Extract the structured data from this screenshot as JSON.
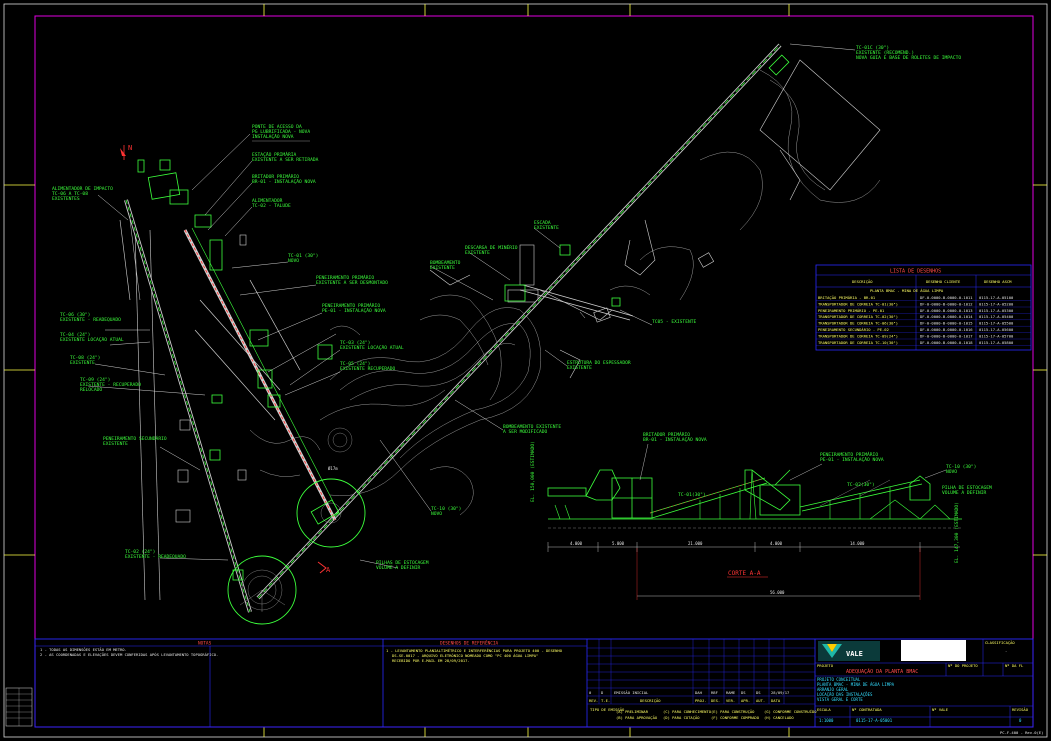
{
  "colors": {
    "background": "#000000",
    "border": "#e000e0",
    "equipment": "#3cff3c",
    "structure": "#d8d8d8",
    "titleblock": "#2a2aff",
    "accent_red": "#ff3333",
    "yellow": "#ffff44",
    "cyan": "#33ddff"
  },
  "north_mark": "N",
  "cut_marker": "A",
  "callouts": [
    {
      "id": "ponte",
      "lines": [
        "PONTE DE ACESSO DA",
        "PG LUBRIFICADA - NOVA",
        "INSTALAÇÃO NOVA"
      ]
    },
    {
      "id": "estacao",
      "lines": [
        "ESTAÇÃO PRIMÁRIA",
        "EXISTENTE A SER RETIRADA"
      ]
    },
    {
      "id": "britador",
      "lines": [
        "BRITADOR PRIMÁRIO",
        "BR-01 - INSTALAÇÃO NOVA"
      ]
    },
    {
      "id": "alimentador",
      "lines": [
        "ALIMENTADOR",
        "TC-02 - TALUDE"
      ]
    },
    {
      "id": "tc01",
      "lines": [
        "TC-01 (30\")",
        "NOVO"
      ]
    },
    {
      "id": "peneira",
      "lines": [
        "PENEIRAMENTO PRIMÁRIO",
        "EXISTENTE A SER DESMONTADO"
      ]
    },
    {
      "id": "peneira2",
      "lines": [
        "PENEIRAMENTO PRIMÁRIO",
        "PE-01 - INSTALAÇÃO NOVA"
      ]
    },
    {
      "id": "tc03",
      "lines": [
        "TC-03 (24\")",
        "EXISTENTE LOCAÇÃO ATUAL"
      ]
    },
    {
      "id": "tc05",
      "lines": [
        "TC-05 (24\")",
        "EXISTENTE RECUPERADO"
      ]
    },
    {
      "id": "tc06",
      "lines": [
        "TC-06 (30\")",
        "EXISTENTE - READEQUADO"
      ]
    },
    {
      "id": "tc04",
      "lines": [
        "TC-04 (24\")",
        "EXISTENTE LOCAÇÃO ATUAL"
      ]
    },
    {
      "id": "tc08",
      "lines": [
        "TC-08 (24\")",
        "EXISTENTE"
      ]
    },
    {
      "id": "tc09",
      "lines": [
        "TC-09 (24\")",
        "EXISTENTE - RECUPERADO",
        "RELOCADO"
      ]
    },
    {
      "id": "peneira_sec",
      "lines": [
        "PENEIRAMENTO SECUNDÁRIO",
        "EXISTENTE"
      ]
    },
    {
      "id": "tc02",
      "lines": [
        "TC-02 (24\")",
        "EXISTENTE - READEQUADO"
      ]
    },
    {
      "id": "tc10",
      "lines": [
        "TC-10 (30\")",
        "NOVO"
      ]
    },
    {
      "id": "pilhas",
      "lines": [
        "PILHAS DE ESTOCAGEM",
        "VOLUME A DEFINIR"
      ]
    },
    {
      "id": "espessador",
      "lines": [
        "ESTRUTURA DO ESPESSADOR",
        "EXISTENTE"
      ]
    },
    {
      "id": "tc05b",
      "lines": [
        "TC05 - EXISTENTE"
      ]
    },
    {
      "id": "descarga",
      "lines": [
        "DESCARGA DE MINÉRIO",
        "EXISTENTE"
      ]
    },
    {
      "id": "bombeamento",
      "lines": [
        "BOMBEAMENTO",
        "EXISTENTE"
      ]
    },
    {
      "id": "escada",
      "lines": [
        "ESCADA",
        "EXISTENTE"
      ]
    },
    {
      "id": "bombeamento2",
      "lines": [
        "BOMBEAMENTO EXISTENTE",
        "A SER MODIFICADO"
      ]
    },
    {
      "id": "tc01c",
      "lines": [
        "TC-01C (30\")",
        "EXISTENTE (RECOMEND.)",
        "NOVA GUIA E BASE DE ROLETES DE IMPACTO"
      ]
    },
    {
      "id": "alim_impacto",
      "lines": [
        "ALIMENTADOR DE IMPACTO",
        "TC-06 A TC-08",
        "EXISTENTES"
      ]
    },
    {
      "id": "pilha_dim",
      "lines": [
        "Ø17m"
      ]
    }
  ],
  "section": {
    "title": "CORTE A-A",
    "callouts": [
      {
        "id": "s_britador",
        "lines": [
          "BRITADOR PRIMÁRIO",
          "BR-01 - INSTALAÇÃO NOVA"
        ]
      },
      {
        "id": "s_peneira",
        "lines": [
          "PENEIRAMENTO PRIMÁRIO",
          "PE-01 - INSTALAÇÃO NOVA"
        ]
      },
      {
        "id": "s_tc10",
        "lines": [
          "TC-10 (30\")",
          "NOVO"
        ]
      },
      {
        "id": "s_pilha",
        "lines": [
          "PILHA DE ESTOCAGEM",
          "VOLUME A DEFINIR"
        ]
      },
      {
        "id": "s_tc01",
        "lines": [
          "TC-01(30\")"
        ]
      },
      {
        "id": "s_tc02",
        "lines": [
          "TC-02(30\")"
        ]
      }
    ],
    "dims": [
      "4.000",
      "5.000",
      "21.000",
      "4.000",
      "14.000"
    ],
    "total_dim": "56.000",
    "level_left": "EL. 150,000 (ESTIMADO)",
    "level_right": "EL. 147,300 (ESTIMADO)"
  },
  "table": {
    "title": "LISTA DE DESENHOS",
    "headers": [
      "DESCRIÇÃO",
      "DESENHO CLIENTE",
      "DESENHO ASCM"
    ],
    "subtitle": "PLANTA BMAC - MINA DE ÁGUA LIMPA",
    "rows": [
      [
        "BRITAÇÃO PRIMÁRIA - BR-01",
        "DF-0-0000-B-0000-0-1011",
        "0115-17-A-05100"
      ],
      [
        "TRANSPORTADOR DE CORREIA TC-01(30\")",
        "DF-0-0000-B-0000-0-1012",
        "0115-17-A-05200"
      ],
      [
        "PENEIRAMENTO PRIMÁRIO - PE-01",
        "DF-0-0000-B-0000-0-1013",
        "0115-17-A-05300"
      ],
      [
        "TRANSPORTADOR DE CORREIA TC-02(30\")",
        "DF-0-0000-B-0000-0-1014",
        "0115-17-A-05400"
      ],
      [
        "TRANSPORTADOR DE CORREIA TC-06(30\")",
        "DF-0-0000-B-0000-0-1015",
        "0115-17-A-05500"
      ],
      [
        "PENEIRAMENTO SECUNDÁRIO - PE-02",
        "DF-0-0000-B-0000-0-1016",
        "0115-17-A-05600"
      ],
      [
        "TRANSPORTADOR DE CORREIA TC-09(24\")",
        "DF-0-0000-B-0000-0-1017",
        "0115-17-A-05700"
      ],
      [
        "TRANSPORTADOR DE CORREIA TC-10(30\")",
        "DF-0-0000-B-0000-0-1018",
        "0115-17-A-05800"
      ]
    ]
  },
  "notes": {
    "title": "NOTAS",
    "lines": [
      "1 - TODAS AS DIMENSÕES ESTÃO EM METRO.",
      "2 - AS COORDENADAS E ELEVAÇÕES DEVEM CONFERIDAS APÓS LEVANTAMENTO TOPOGRÁFICO."
    ]
  },
  "refs": {
    "title": "DESENHOS DE REFERÊNCIA",
    "lines": [
      "1 - LEVANTAMENTO PLANIALTIMÉTRICO E INTERFERÊNCIAS PARA PROJETO 400 - DESENHO",
      "DS-SE-0017 - ARQUIVO ELETRÔNICO NOMEADO COMO \"PC 400 ÁGUA LIMPA\"",
      "RECEBIDO POR E-MAIL EM 28/09/2017."
    ]
  },
  "revisions": {
    "headers": [
      "REV.",
      "T.E.",
      "DESCRIÇÃO",
      "PROJ.",
      "DES.",
      "VER.",
      "APR.",
      "AUT.",
      "DATA"
    ],
    "rows": [
      [
        "0",
        "D",
        "EMISSÃO INICIAL",
        "DAH",
        "RBF",
        "RAME",
        "DS",
        "DS",
        "28/09/17"
      ]
    ],
    "tipo_label": "TIPO DE EMISSÃO",
    "tipos": [
      "(A) PRELIMINAR",
      "(B) PARA APROVAÇÃO",
      "(C) PARA CONHECIMENTO",
      "(D) PARA COTAÇÃO",
      "(E) PARA CONSTRUÇÃO",
      "(F) CONFORME COMPRADO",
      "(G) CONFORME CONSTRUÍDO",
      "(H) CANCELADO"
    ]
  },
  "titleblock": {
    "logo": "VALE",
    "classificacao_label": "CLASSIFICAÇÃO",
    "classificacao": "-",
    "projeto_label": "PROJETO",
    "project_title": "ADEQUAÇÃO DA PLANTA BMAC",
    "area_lines": [
      "PROJETO CONCEITUAL",
      "PLANTA BMAC - MINA DE ÁGUA LIMPA",
      "ARRANJO GERAL",
      "LOCAÇÃO DAS INSTALAÇÕES",
      "VISTA GERAL E CORTE"
    ],
    "no_projeto_label": "Nº DO PROJETO",
    "folha_label": "Nº DA FL",
    "escala_label": "ESCALA",
    "escala": "1:1000",
    "contratada_label": "Nº CONTRATADA",
    "contratada": "0115-17-A-05001",
    "vale_label": "Nº VALE",
    "revisao_label": "REVISÃO",
    "revisao": "0",
    "footer": "PC-F-400 - Rev.0(E)"
  }
}
